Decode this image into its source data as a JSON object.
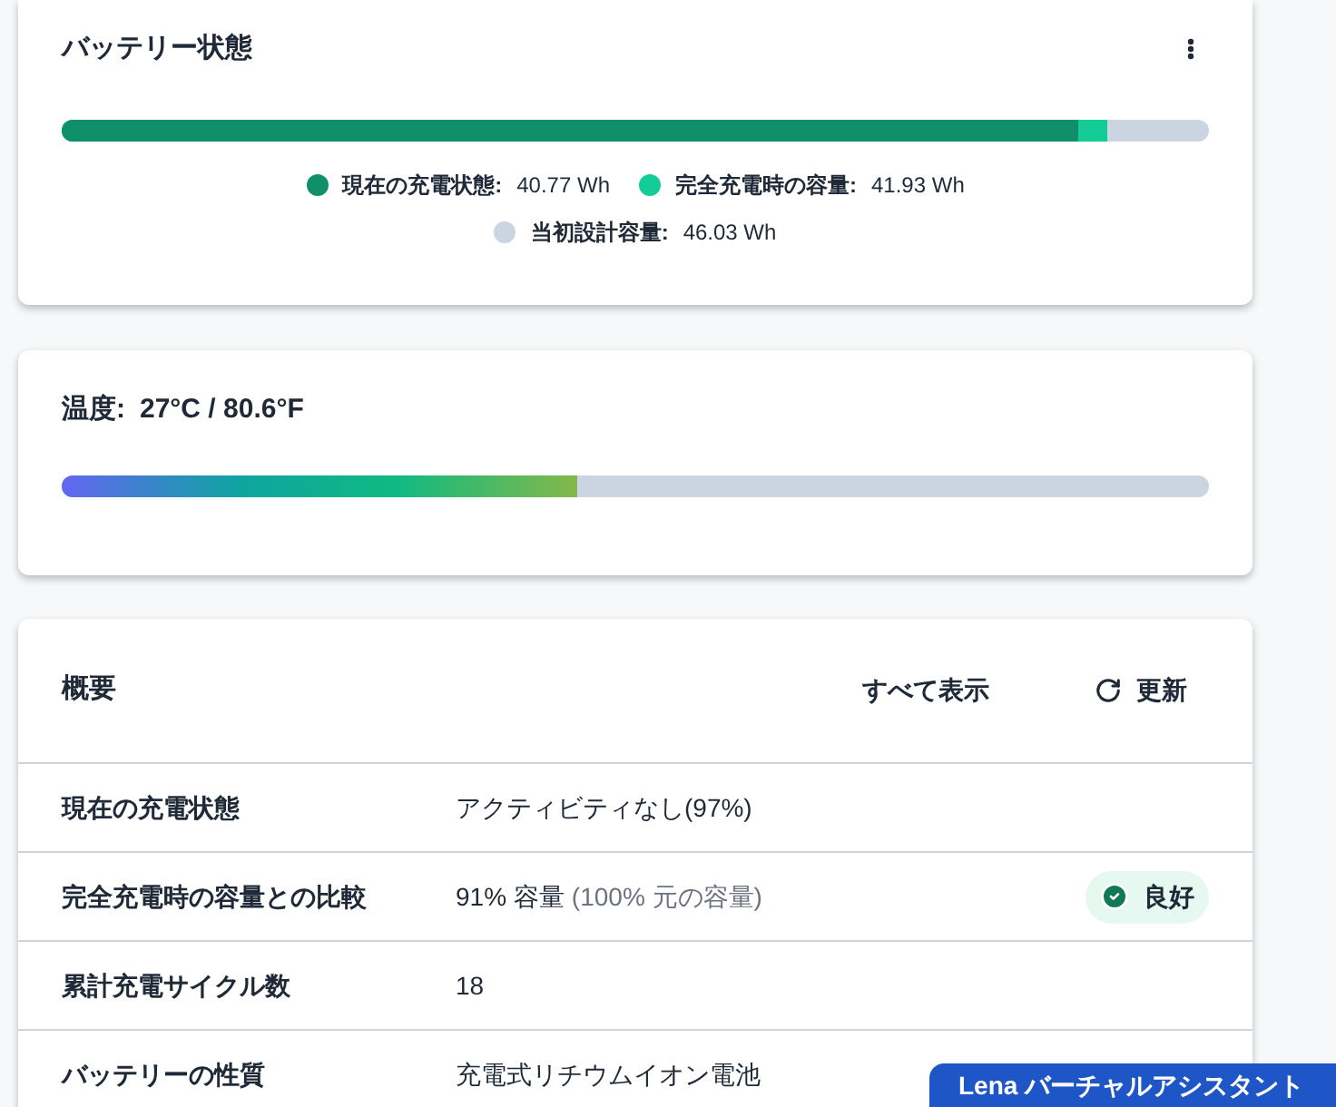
{
  "battery_card": {
    "title": "バッテリー状態",
    "legend": [
      {
        "label": "現在の充電状態:",
        "value": "40.77 Wh",
        "color": "#0f9068",
        "level": 0.886
      },
      {
        "label": "完全充電時の容量:",
        "value": "41.93 Wh",
        "color": "#14cc96",
        "level": 0.911
      },
      {
        "label": "当初設計容量:",
        "value": "46.03 Wh",
        "color": "#cbd5e1"
      }
    ]
  },
  "temperature_card": {
    "label": "温度:",
    "value": "27°C / 80.6°F",
    "level": 0.45
  },
  "summary": {
    "title": "概要",
    "actions": [
      "すべて表示",
      "更新"
    ],
    "rows": [
      {
        "label": "現在の充電状態",
        "value": "アクティビティなし(97%)"
      },
      {
        "label": "完全充電時の容量との比較",
        "value": "91% 容量",
        "note": "(100% 元の容量)",
        "badge": "良好"
      },
      {
        "label": "累計充電サイクル数",
        "value": "18"
      },
      {
        "label": "バッテリーの性質",
        "value": "充電式リチウムイオン電池"
      }
    ]
  },
  "assistant_tab": {
    "label": "Lena バーチャルアシスタント"
  }
}
